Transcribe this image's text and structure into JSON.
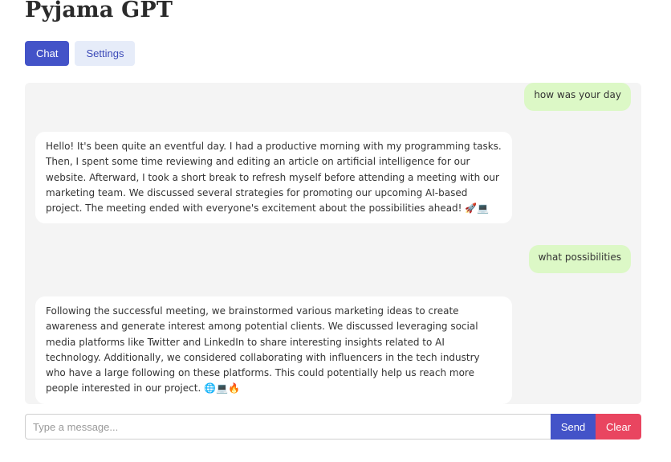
{
  "app": {
    "title": "Pyjama GPT"
  },
  "tabs": [
    {
      "label": "Chat",
      "active": true
    },
    {
      "label": "Settings",
      "active": false
    }
  ],
  "messages": [
    {
      "role": "user",
      "text": "how was your day"
    },
    {
      "role": "bot",
      "text": "Hello! It's been quite an eventful day. I had a productive morning with my programming tasks. Then, I spent some time reviewing and editing an article on artificial intelligence for our website. Afterward, I took a short break to refresh myself before attending a meeting with our marketing team. We discussed several strategies for promoting our upcoming AI-based project. The meeting ended with everyone's excitement about the possibilities ahead! 🚀💻"
    },
    {
      "role": "user",
      "text": "what possibilities"
    },
    {
      "role": "bot",
      "text": "Following the successful meeting, we brainstormed various marketing ideas to create awareness and generate interest among potential clients. We discussed leveraging social media platforms like Twitter and LinkedIn to share interesting insights related to AI technology. Additionally, we considered collaborating with influencers in the tech industry who have a large following on these platforms. This could potentially help us reach more people interested in our project. 🌐💻🔥"
    }
  ],
  "composer": {
    "placeholder": "Type a message...",
    "value": "",
    "send_label": "Send",
    "clear_label": "Clear"
  },
  "colors": {
    "primary": "#4353c8",
    "danger": "#e94560",
    "user_bubble": "#dcf8c6",
    "chat_bg": "#f4f4f4"
  }
}
